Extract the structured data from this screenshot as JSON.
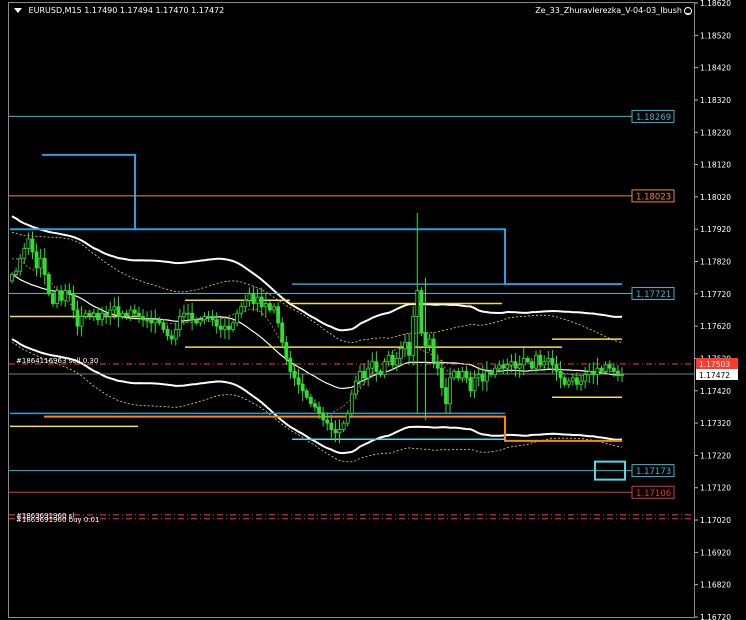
{
  "header": {
    "symbol": "EURUSD,M15",
    "ohlc": "1.17490 1.17494 1.17470 1.17472",
    "indicator": "Ze_33_Zhuravlerezka_V-04-03_Ibush"
  },
  "colors": {
    "background": "#000000",
    "grid_border": "#8a8a8a",
    "candle": "#33dd33",
    "blue_line": "#2e9ee0",
    "white_band": "#ffffff",
    "yellow": "#f5e04a",
    "orange": "#ff8800",
    "red": "#ff3b2f",
    "cyan": "#5fd4e6",
    "cyan_label": "#34b7d6",
    "orange_label": "#f08d28",
    "red_label": "#e33b2e"
  },
  "orders": [
    {
      "text": "#1864116963 sell 0.30"
    },
    {
      "text": "#1863691960 sl"
    },
    {
      "text": "#1863691960 buy 0.01"
    }
  ],
  "chart_data": {
    "type": "candlestick",
    "symbol": "EURUSD",
    "timeframe": "M15",
    "ylim": [
      1.1672,
      1.1862
    ],
    "y_ticks": [
      "1.18620",
      "1.18520",
      "1.18420",
      "1.18320",
      "1.18220",
      "1.18120",
      "1.18020",
      "1.17920",
      "1.17820",
      "1.17720",
      "1.17620",
      "1.17520",
      "1.17420",
      "1.17320",
      "1.17220",
      "1.17120",
      "1.17020",
      "1.16920",
      "1.16820",
      "1.16720"
    ],
    "y_tick_values": [
      1.1862,
      1.1852,
      1.1842,
      1.1832,
      1.1822,
      1.1812,
      1.1802,
      1.1792,
      1.1782,
      1.1772,
      1.1762,
      1.1752,
      1.1742,
      1.1732,
      1.1722,
      1.1712,
      1.1702,
      1.1692,
      1.1682,
      1.1672
    ],
    "current_price": {
      "value": 1.17472,
      "label": "1.17472"
    },
    "ask_label": {
      "value": 1.17503,
      "label": "1.17503"
    },
    "levels": [
      {
        "name": "level-1.18269",
        "value": 1.18269,
        "label": "1.18269",
        "color": "#34b7d6"
      },
      {
        "name": "level-1.18023",
        "value": 1.18023,
        "label": "1.18023",
        "color": "#f08d28"
      },
      {
        "name": "level-1.17721",
        "value": 1.17721,
        "label": "1.17721",
        "color": "#34b7d6"
      },
      {
        "name": "level-1.17173",
        "value": 1.17173,
        "label": "1.17173",
        "color": "#34b7d6"
      },
      {
        "name": "level-1.17106",
        "value": 1.17106,
        "label": "1.17106",
        "color": "#e33b2e"
      }
    ],
    "order_lines": [
      {
        "name": "sell-order-line",
        "value": 1.17503
      },
      {
        "name": "sl-line",
        "value": 1.17036
      },
      {
        "name": "buy-order-line",
        "value": 1.17024
      }
    ],
    "bar_count": 150,
    "closes": [
      1.1778,
      1.1779,
      1.1783,
      1.1786,
      1.1789,
      1.1785,
      1.178,
      1.1783,
      1.1778,
      1.1772,
      1.1769,
      1.1773,
      1.177,
      1.1773,
      1.1772,
      1.1767,
      1.1762,
      1.1765,
      1.1766,
      1.1765,
      1.1766,
      1.1764,
      1.1766,
      1.1765,
      1.1767,
      1.1768,
      1.1765,
      1.1766,
      1.1765,
      1.1767,
      1.1766,
      1.1765,
      1.1764,
      1.1764,
      1.1763,
      1.1764,
      1.1763,
      1.1761,
      1.1759,
      1.1758,
      1.1761,
      1.1765,
      1.1766,
      1.1766,
      1.1764,
      1.1763,
      1.1764,
      1.1765,
      1.1765,
      1.1764,
      1.1762,
      1.1761,
      1.1762,
      1.1761,
      1.1763,
      1.1766,
      1.1768,
      1.177,
      1.1772,
      1.1769,
      1.1771,
      1.1768,
      1.1769,
      1.1767,
      1.1768,
      1.1763,
      1.1757,
      1.1752,
      1.1748,
      1.1746,
      1.1744,
      1.1742,
      1.174,
      1.1738,
      1.1737,
      1.1735,
      1.1733,
      1.1732,
      1.173,
      1.1729,
      1.173,
      1.1732,
      1.1735,
      1.1741,
      1.1745,
      1.1748,
      1.1746,
      1.1749,
      1.1751,
      1.1748,
      1.1747,
      1.1751,
      1.1753,
      1.175,
      1.1752,
      1.1755,
      1.1757,
      1.1753,
      1.1765,
      1.1773,
      1.176,
      1.1756,
      1.1758,
      1.1751,
      1.1749,
      1.1743,
      1.1738,
      1.1746,
      1.1748,
      1.1746,
      1.1748,
      1.1746,
      1.1742,
      1.1746,
      1.1747,
      1.1745,
      1.1748,
      1.1747,
      1.1749,
      1.175,
      1.1749,
      1.175,
      1.1751,
      1.1749,
      1.175,
      1.1752,
      1.1751,
      1.1749,
      1.1753,
      1.175,
      1.1751,
      1.1752,
      1.175,
      1.1748,
      1.1746,
      1.1744,
      1.1745,
      1.1746,
      1.1744,
      1.1745,
      1.1747,
      1.1748,
      1.1747,
      1.1749,
      1.1748,
      1.175,
      1.1749,
      1.1748,
      1.1747,
      1.1747
    ],
    "annotated_spikes": [
      {
        "bar": 99,
        "high": 1.1797,
        "low": 1.1735
      },
      {
        "bar": 101,
        "high": 1.1777,
        "low": 1.1733
      }
    ]
  }
}
